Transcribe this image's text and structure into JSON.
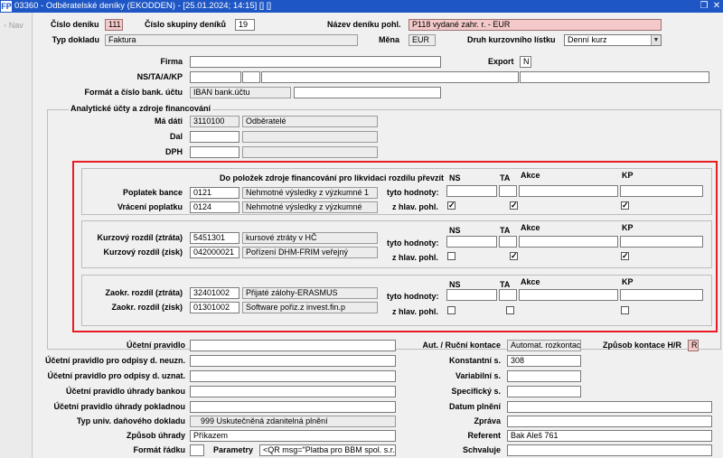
{
  "window": {
    "title": "03360 - Odběratelské deníky (EKODDEN) - [25.01.2024; 14:15] [] []",
    "app_icon": "FP"
  },
  "nav": {
    "label": "Nav"
  },
  "header": {
    "cislo_deniku_label": "Číslo deníku",
    "cislo_deniku": "111",
    "cislo_skupiny_label": "Číslo skupiny deníků",
    "cislo_skupiny": "19",
    "nazev_label": "Název deníku pohl.",
    "nazev": "P118 vydané zahr. r. - EUR",
    "typ_dokladu_label": "Typ dokladu",
    "typ_dokladu": "Faktura",
    "mena_label": "Měna",
    "mena": "EUR",
    "druh_kurz_label": "Druh kurzovního lístku",
    "druh_kurz": "Denní kurz"
  },
  "firm": {
    "firma_label": "Firma",
    "export_label": "Export",
    "export": "N",
    "ns_label": "NS/TA/A/KP",
    "format_label": "Formát a číslo bank. účtu",
    "format": "IBAN bank.účtu"
  },
  "analytics": {
    "group_title": "Analytické účty a zdroje financování",
    "ma_dati_label": "Má dáti",
    "ma_dati_code": "3110100",
    "ma_dati_name": "Odběratelé",
    "dal_label": "Dal",
    "dph_label": "DPH"
  },
  "red_section": {
    "heading": "Do položek zdroje financování pro likvidaci rozdílu převzít",
    "col_ns": "NS",
    "col_ta": "TA",
    "col_akce": "Akce",
    "col_kp": "KP",
    "tyto_label": "tyto hodnoty:",
    "hlav_label": "z hlav. pohl.",
    "groups": [
      {
        "row1_label": "Poplatek bance",
        "row1_code": "0121",
        "row1_name": "Nehmotné výsledky z výzkumné 1",
        "row2_label": "Vrácení poplatku",
        "row2_code": "0124",
        "row2_name": "Nehmotné výsledky z výzkumné",
        "ns_checked": "✓",
        "ta_checked": "✓",
        "kp_checked": "✓"
      },
      {
        "row1_label": "Kurzový rozdíl (ztráta)",
        "row1_code": "5451301",
        "row1_name": "kursové ztráty v HČ",
        "row2_label": "Kurzový rozdíl (zisk)",
        "row2_code": "042000021",
        "row2_name": "Pořízení DHM-FRIM veřejný",
        "ns_checked": "",
        "ta_checked": "✓",
        "kp_checked": "✓"
      },
      {
        "row1_label": "Zaokr. rozdíl (ztráta)",
        "row1_code": "32401002",
        "row1_name": "Přijaté zálohy-ERASMUS",
        "row2_label": "Zaokr. rozdíl (zisk)",
        "row2_code": "01301002",
        "row2_name": "Software pořiz.z invest.fin.p",
        "ns_checked": "",
        "ta_checked": "",
        "kp_checked": ""
      }
    ]
  },
  "bottom": {
    "ucetni_pravidlo_label": "Účetní pravidlo",
    "odpisy_neuzn_label": "Účetní pravidlo pro odpisy d. neuzn.",
    "odpisy_uzn_label": "Účetní pravidlo pro odpisy d. uznat.",
    "uhrady_bankou_label": "Účetní pravidlo úhrady bankou",
    "uhrady_pokladnou_label": "Účetní pravidlo úhrady pokladnou",
    "typ_univ_label": "Typ univ. daňového dokladu",
    "typ_univ_code": "999",
    "typ_univ_name": "Uskutečněná zdanitelná plnění",
    "zpusob_uhrady_label": "Způsob úhrady",
    "zpusob_uhrady": "Příkazem",
    "format_radku_label": "Formát řádku",
    "parametry_label": "Parametry",
    "parametry": "<QR msg=\"Platba pro BBM spol. s.r.o.\"",
    "aut_rucni_label": "Aut. / Ruční kontace",
    "aut_rucni": "Automat. rozkontace",
    "zpusob_kontace_label": "Způsob kontace H/R",
    "zpusob_kontace": "R",
    "konstantni_label": "Konstantní s.",
    "konstantni": "308",
    "variabilni_label": "Variabilní s.",
    "specificky_label": "Specifický s.",
    "datum_plneni_label": "Datum plnění",
    "zprava_label": "Zpráva",
    "referent_label": "Referent",
    "referent": "Bak Aleš 761",
    "schvaluje_label": "Schvaluje"
  }
}
